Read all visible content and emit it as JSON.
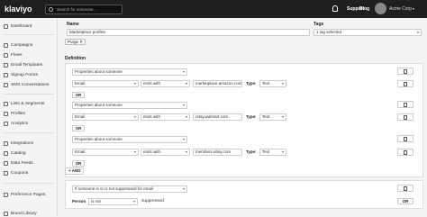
{
  "topbar": {
    "logo": "klaviyo",
    "search_placeholder": "Search for someone...",
    "support": "Support",
    "blog": "Blog",
    "account": "Acme Corp"
  },
  "sidebar": {
    "items": [
      {
        "label": "Dashboard",
        "icon": "dashboard-icon"
      },
      {
        "label": "Campaigns",
        "icon": "campaigns-icon"
      },
      {
        "label": "Flows",
        "icon": "flows-icon"
      },
      {
        "label": "Email Templates",
        "icon": "email-templates-icon"
      },
      {
        "label": "Signup Forms",
        "icon": "signup-forms-icon"
      },
      {
        "label": "SMS Conversations",
        "icon": "sms-icon"
      },
      {
        "label": "Lists & Segments",
        "icon": "lists-icon"
      },
      {
        "label": "Profiles",
        "icon": "profiles-icon"
      },
      {
        "label": "Analytics",
        "icon": "analytics-icon"
      },
      {
        "label": "Integrations",
        "icon": "integrations-icon"
      },
      {
        "label": "Catalog",
        "icon": "catalog-icon"
      },
      {
        "label": "Data Feeds",
        "icon": "data-feeds-icon"
      },
      {
        "label": "Coupons",
        "icon": "coupons-icon"
      },
      {
        "label": "Preference Pages",
        "icon": "preference-pages-icon"
      },
      {
        "label": "Brand Library",
        "icon": "brand-library-icon"
      }
    ]
  },
  "form": {
    "name_label": "Name",
    "name_value": "Marketplace profiles",
    "tags_label": "Tags",
    "tags_value": "1 tag selected",
    "tag_chip": "Purge",
    "definition_label": "Definition",
    "condition_type": "Properties about someone",
    "property": "Email",
    "operator": "ends with",
    "type_label": "Type:",
    "type_value": "Text",
    "or_label": "OR",
    "values": [
      "marketplace.amazon.com",
      "relay.walmart.com",
      "members.ebay.com"
    ],
    "and_label": "+ AND",
    "suppress_condition": "If someone is or is not suppressed for email",
    "person_label": "Person",
    "person_value": "is not",
    "suppressed_label": "suppressed"
  }
}
